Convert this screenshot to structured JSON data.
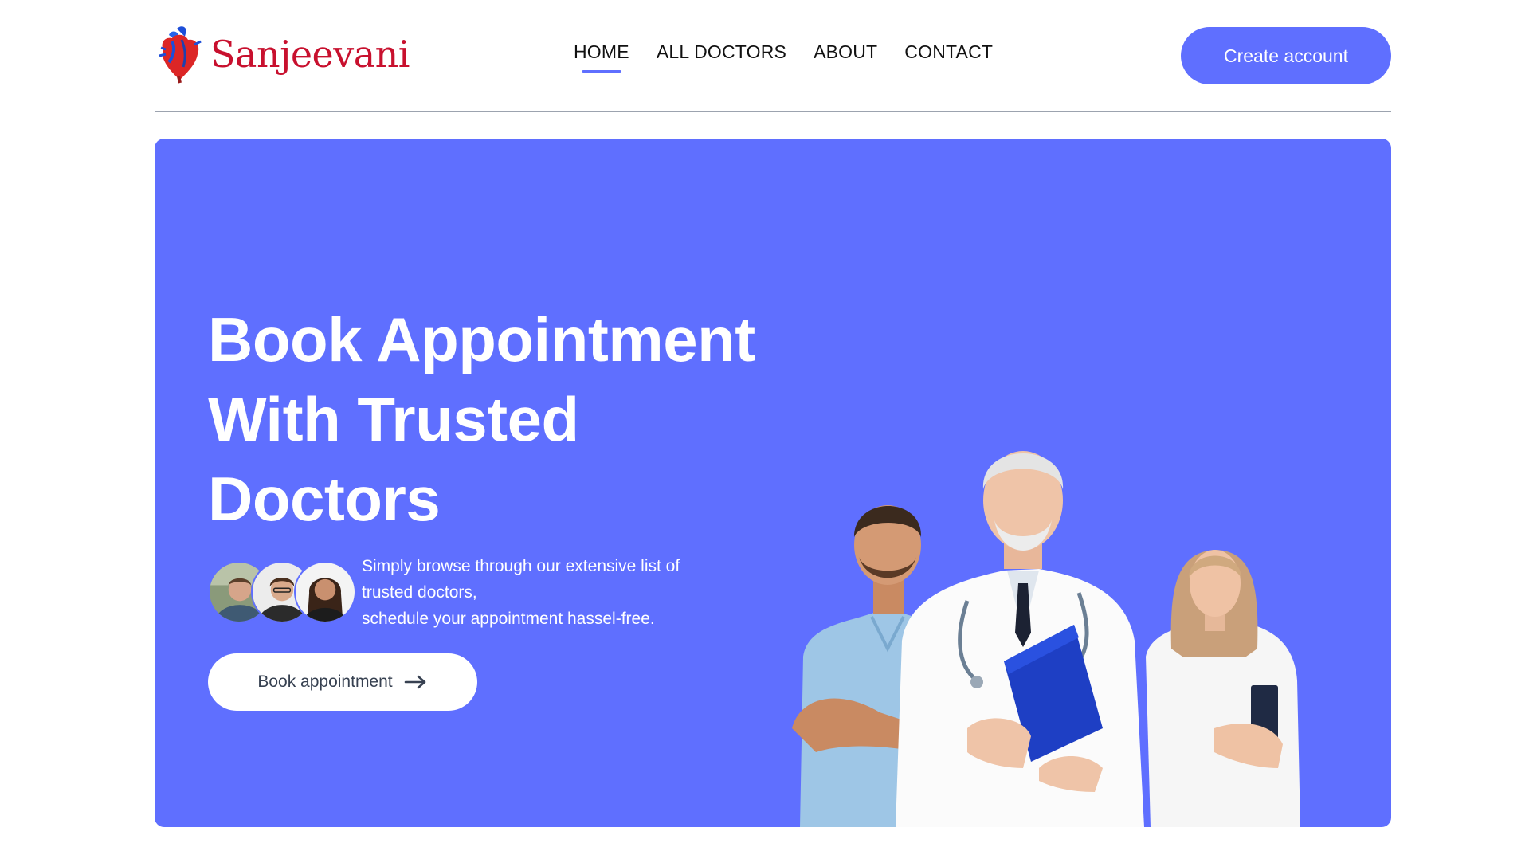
{
  "brand": {
    "name": "Sanjeevani",
    "logo_icon": "heart-logo-icon",
    "color": "#c8102e"
  },
  "nav": {
    "items": [
      {
        "label": "HOME",
        "active": true
      },
      {
        "label": "ALL DOCTORS",
        "active": false
      },
      {
        "label": "ABOUT",
        "active": false
      },
      {
        "label": "CONTACT",
        "active": false
      }
    ],
    "cta_label": "Create account"
  },
  "hero": {
    "title_lines": [
      "Book Appointment",
      "With Trusted",
      "Doctors"
    ],
    "description_lines": [
      "Simply browse through our extensive list of",
      "trusted doctors,",
      "schedule your appointment hassel-free."
    ],
    "button_label": "Book appointment",
    "button_icon": "arrow-right-icon",
    "background": "#5f6fff"
  },
  "colors": {
    "primary": "#5f6fff",
    "text_dark": "#111111"
  }
}
